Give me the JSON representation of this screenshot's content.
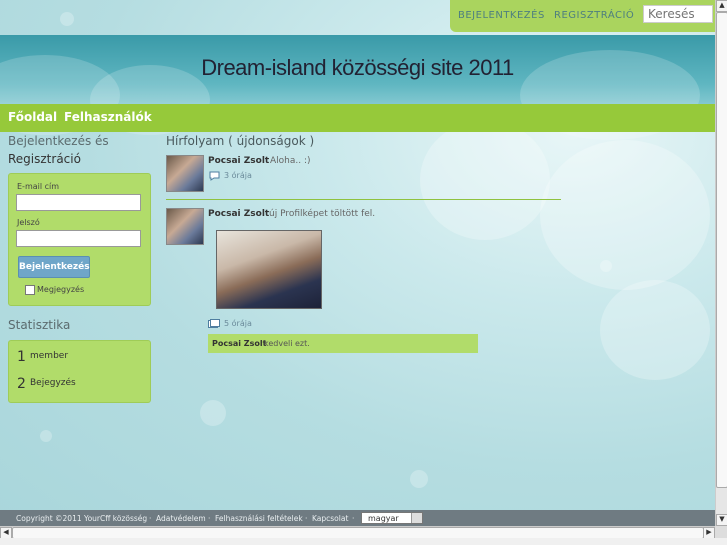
{
  "topbar": {
    "login_link": "BEJELENTKEZÉS",
    "register_link": "REGISZTRÁCIÓ",
    "search_placeholder": "Keresés"
  },
  "header": {
    "title": "Dream-island közösségi site 2011"
  },
  "nav": {
    "items": [
      "Főoldal",
      "Felhasználók"
    ]
  },
  "sidebar": {
    "login_title_line1": "Bejelentkezés és",
    "login_title_line2": "Regisztráció",
    "email_label": "E-mail cím",
    "password_label": "Jelszó",
    "login_button": "Bejelentkezés",
    "remember_label": "Megjegyzés",
    "stats_title": "Statisztika",
    "stats": [
      {
        "count": "1",
        "label": "member"
      },
      {
        "count": "2",
        "label": "Bejegyzés"
      }
    ]
  },
  "feed": {
    "title": "Hírfolyam ( újdonságok )",
    "posts": [
      {
        "author": "Pocsai Zsolt",
        "text": "Aloha.. :)",
        "time": "3 órája"
      },
      {
        "author": "Pocsai Zsolt",
        "text": "új Profilképet töltött fel.",
        "time": "5 órája"
      }
    ],
    "like": {
      "author": "Pocsai Zsolt",
      "text": "kedveli ezt."
    }
  },
  "footer": {
    "copyright": "Copyright ©2011 YourCff közösség",
    "links": [
      "Adatvédelem",
      "Felhasználási feltételek",
      "Kapcsolat"
    ],
    "language": "magyar"
  },
  "colors": {
    "accent_green": "#96c93a",
    "box_green": "#b1dc6a",
    "header_teal": "#3a9aa8"
  }
}
